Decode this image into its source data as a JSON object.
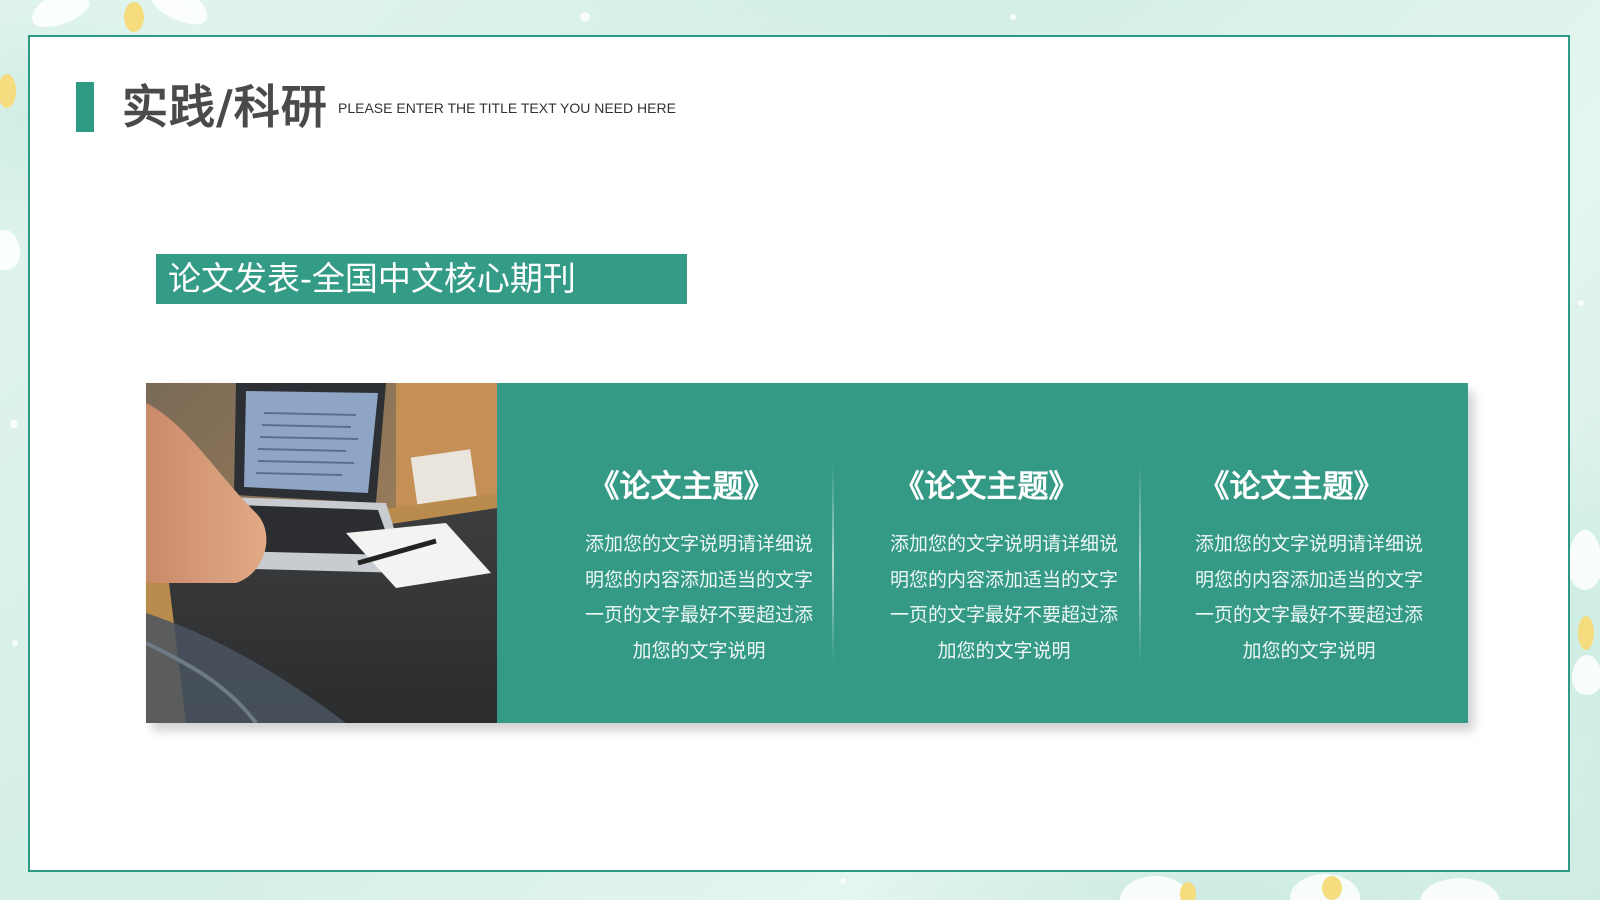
{
  "slide": {
    "title": "实践/科研",
    "subtitle": "PLEASE ENTER THE TITLE TEXT YOU NEED HERE",
    "section_label": "论文发表-全国中文核心期刊"
  },
  "columns": [
    {
      "title": "《论文主题》",
      "lines": [
        "添加您的文字说明请详细说",
        "明您的内容添加适当的文字",
        "一页的文字最好不要超过添",
        "加您的文字说明"
      ]
    },
    {
      "title": "《论文主题》",
      "lines": [
        "添加您的文字说明请详细说",
        "明您的内容添加适当的文字",
        "一页的文字最好不要超过添",
        "加您的文字说明"
      ]
    },
    {
      "title": "《论文主题》",
      "lines": [
        "添加您的文字说明请详细说",
        "明您的内容添加适当的文字",
        "一页的文字最好不要超过添",
        "加您的文字说明"
      ]
    }
  ],
  "photo": {
    "icon": "laptop-desk-photo"
  },
  "colors": {
    "accent": "#2e9a84",
    "card": "#349a86",
    "title_text": "#4a4a4a",
    "background": "#dff3ec"
  }
}
